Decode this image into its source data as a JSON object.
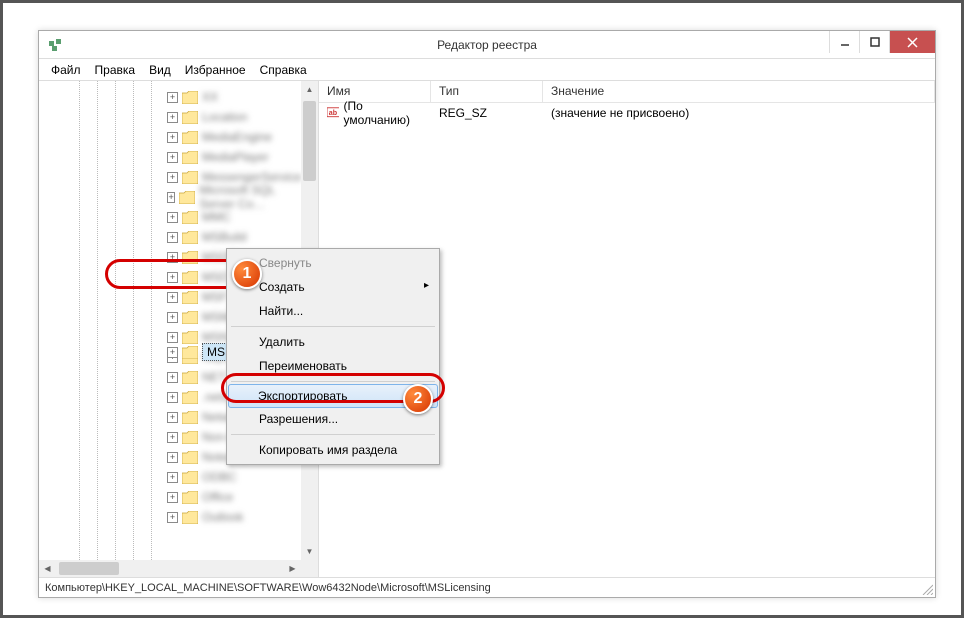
{
  "window": {
    "title": "Редактор реестра"
  },
  "menubar": [
    "Файл",
    "Правка",
    "Вид",
    "Избранное",
    "Справка"
  ],
  "tree": {
    "selected_label": "MSLicensing",
    "blurred_items": [
      "XX",
      "Location",
      "MediaEngine",
      "MediaPlayer",
      "MessengerService",
      "Microsoft SQL Server Co…",
      "MMC",
      "MSBuild",
      "MSDE",
      "MSDTC",
      "MSF",
      "MSMQ",
      "MSN Apps",
      "Multimedia",
      "NapClient",
      "NET Framework",
      ".netsh",
      "Network",
      "Non-Driver Sig…",
      "Notepad",
      "ODBC",
      "Office",
      "Outlook"
    ]
  },
  "list": {
    "headers": [
      "Имя",
      "Тип",
      "Значение"
    ],
    "rows": [
      {
        "name": "(По умолчанию)",
        "type": "REG_SZ",
        "value": "(значение не присвоено)"
      }
    ]
  },
  "context_menu": {
    "items": [
      {
        "label": "Свернуть",
        "state": "disabled"
      },
      {
        "label": "Создать",
        "state": "submenu"
      },
      {
        "label": "Найти...",
        "state": "normal"
      },
      "sep",
      {
        "label": "Удалить",
        "state": "normal"
      },
      {
        "label": "Переименовать",
        "state": "normal"
      },
      "sep",
      {
        "label": "Экспортировать",
        "state": "highlight"
      },
      {
        "label": "Разрешения...",
        "state": "normal"
      },
      "sep",
      {
        "label": "Копировать имя раздела",
        "state": "normal"
      }
    ]
  },
  "statusbar": "Компьютер\\HKEY_LOCAL_MACHINE\\SOFTWARE\\Wow6432Node\\Microsoft\\MSLicensing",
  "callouts": {
    "one": "1",
    "two": "2"
  }
}
